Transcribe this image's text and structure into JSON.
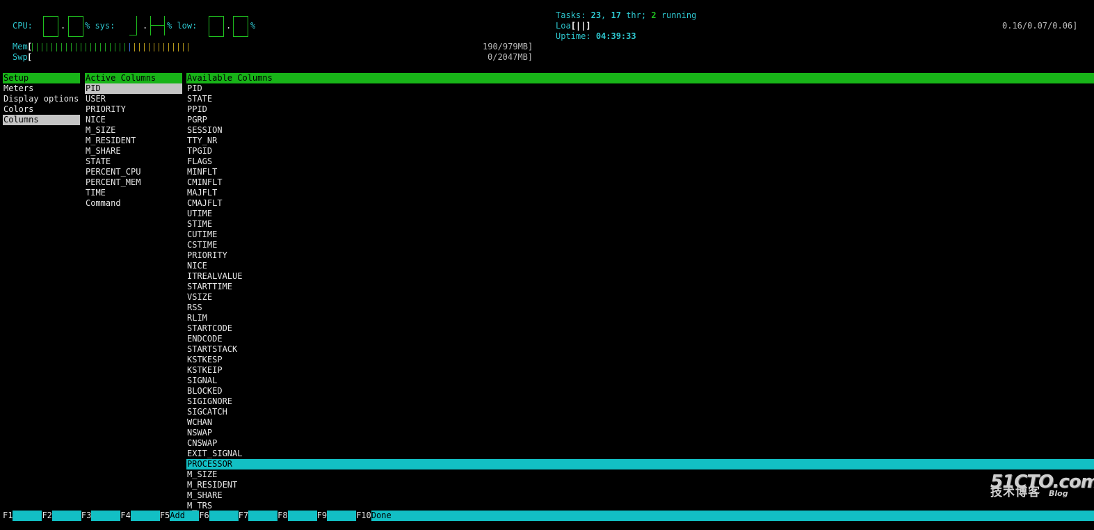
{
  "header": {
    "cpu_label": "CPU:",
    "cpu_dot1": ".",
    "cpu_pct_sys": "% sys:",
    "sys_dot": ".",
    "pct_low": "% low:",
    "low_dot": ".",
    "pct_end": "%",
    "mem_label": "Mem",
    "mem_open": "[",
    "mem_value": "190/979MB]",
    "swp_label": "Swp",
    "swp_open": "[",
    "swp_value": "0/2047MB]",
    "tasks_label": "Tasks:",
    "tasks_count": "23",
    "tasks_sep": ",",
    "threads_count": "17",
    "threads_label": "thr;",
    "running_count": "2",
    "running_label": "running",
    "load_label": "Loa",
    "load_bar": "[||]",
    "load_values": "0.16/0.07/0.06]",
    "uptime_label": "Uptime:",
    "uptime_value": "04:39:33"
  },
  "setup_panel": {
    "header": "Setup",
    "items": [
      "Meters",
      "Display options",
      "Colors",
      "Columns"
    ],
    "selected_index": 3
  },
  "active_panel": {
    "header": "Active Columns",
    "items": [
      "PID",
      "USER",
      "PRIORITY",
      "NICE",
      "M_SIZE",
      "M_RESIDENT",
      "M_SHARE",
      "STATE",
      "PERCENT_CPU",
      "PERCENT_MEM",
      "TIME",
      "Command"
    ],
    "selected_index": 0
  },
  "available_panel": {
    "header": "Available Columns",
    "items": [
      "PID",
      "STATE",
      "PPID",
      "PGRP",
      "SESSION",
      "TTY_NR",
      "TPGID",
      "FLAGS",
      "MINFLT",
      "CMINFLT",
      "MAJFLT",
      "CMAJFLT",
      "UTIME",
      "STIME",
      "CUTIME",
      "CSTIME",
      "PRIORITY",
      "NICE",
      "ITREALVALUE",
      "STARTTIME",
      "VSIZE",
      "RSS",
      "RLIM",
      "STARTCODE",
      "ENDCODE",
      "STARTSTACK",
      "KSTKESP",
      "KSTKEIP",
      "SIGNAL",
      "BLOCKED",
      "SIGIGNORE",
      "SIGCATCH",
      "WCHAN",
      "NSWAP",
      "CNSWAP",
      "EXIT_SIGNAL",
      "PROCESSOR",
      "M_SIZE",
      "M_RESIDENT",
      "M_SHARE",
      "M_TRS"
    ],
    "highlight_index": 36
  },
  "function_bar": [
    {
      "key": "F1",
      "label": ""
    },
    {
      "key": "F2",
      "label": ""
    },
    {
      "key": "F3",
      "label": ""
    },
    {
      "key": "F4",
      "label": ""
    },
    {
      "key": "F5",
      "label": "Add"
    },
    {
      "key": "F6",
      "label": ""
    },
    {
      "key": "F7",
      "label": ""
    },
    {
      "key": "F8",
      "label": ""
    },
    {
      "key": "F9",
      "label": ""
    },
    {
      "key": "F10",
      "label": "Done"
    }
  ],
  "watermark": {
    "brand": "51CTO.com",
    "subtitle": "技术博客",
    "blog": "Blog"
  },
  "colors": {
    "background": "#000000",
    "header_green": "#18b418",
    "cyan": "#12bfc4",
    "selected_gray": "#c4c4c4"
  },
  "mem_bar": {
    "used_green_ticks": 20,
    "used_blue_ticks": 1,
    "used_yellow_ticks": 12
  }
}
